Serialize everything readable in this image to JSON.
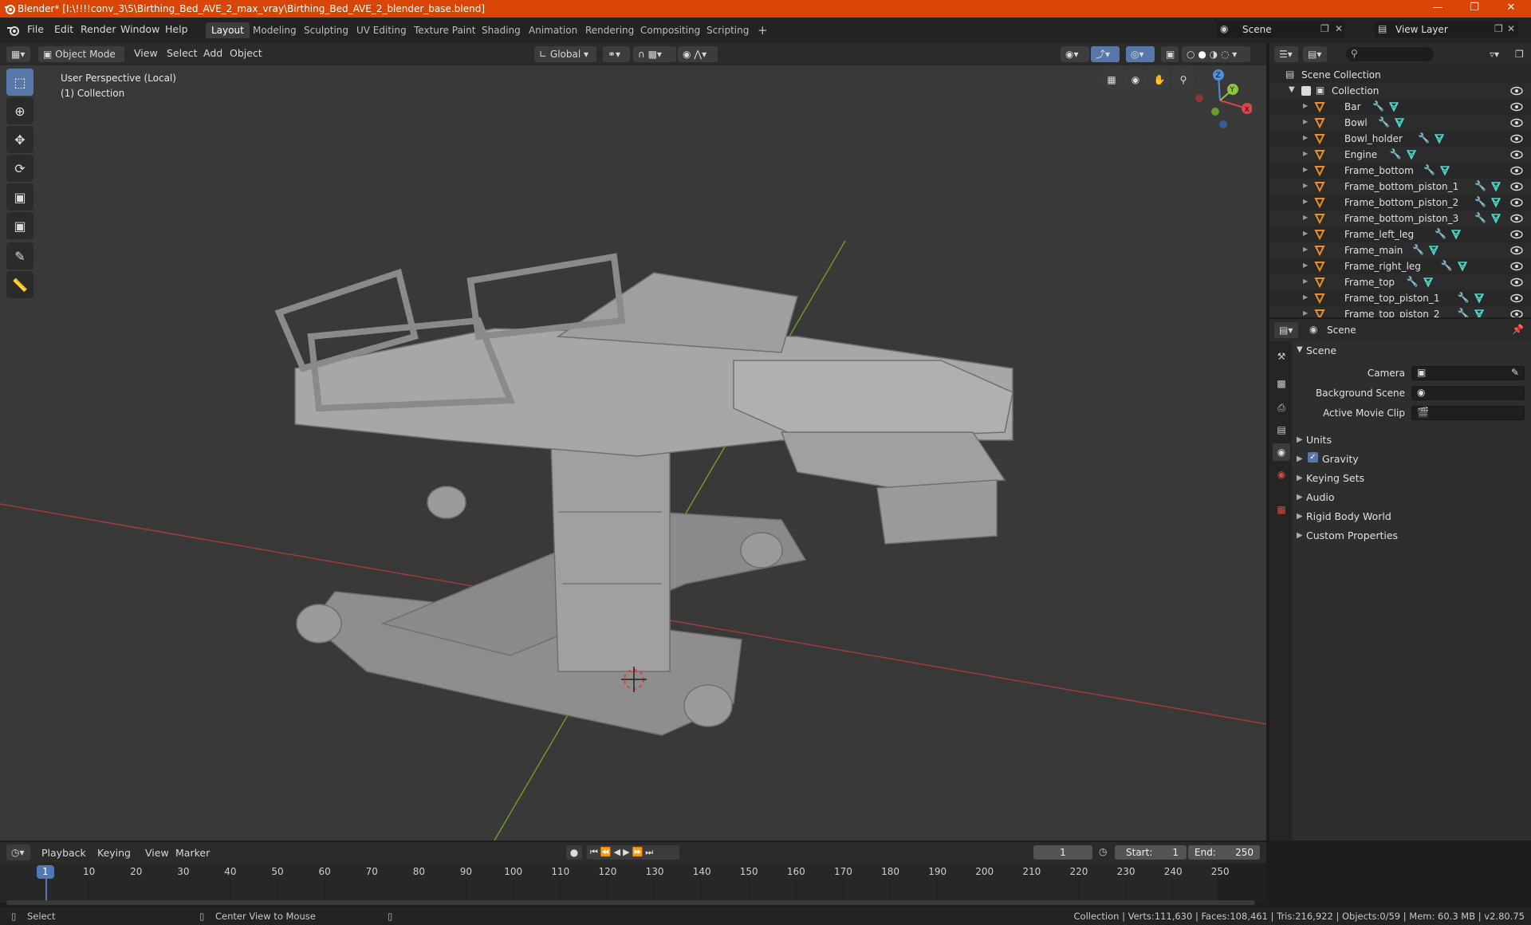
{
  "window": {
    "title": "Blender* [I:\\!!!!conv_3\\5\\Birthing_Bed_AVE_2_max_vray\\Birthing_Bed_AVE_2_blender_base.blend]",
    "min_icon": "minimize-icon",
    "max_icon": "restore-icon",
    "close_icon": "close-icon"
  },
  "menubar": {
    "menus": [
      "File",
      "Edit",
      "Render",
      "Window",
      "Help"
    ],
    "workspaces": [
      "Layout",
      "Modeling",
      "Sculpting",
      "UV Editing",
      "Texture Paint",
      "Shading",
      "Animation",
      "Rendering",
      "Compositing",
      "Scripting"
    ],
    "active_workspace": "Layout",
    "add_tab": "+",
    "scene": "Scene",
    "view_layer": "View Layer"
  },
  "viewport_header": {
    "mode": "Object Mode",
    "menus": [
      "View",
      "Select",
      "Add",
      "Object"
    ],
    "orientation": "Global"
  },
  "viewport": {
    "perspective": "User Perspective (Local)",
    "collection": "(1) Collection",
    "gizmo": {
      "x": "X",
      "y": "Y",
      "z": "Z"
    }
  },
  "outliner": {
    "root": "Scene Collection",
    "collection": "Collection",
    "items": [
      "Bar",
      "Bowl",
      "Bowl_holder",
      "Engine",
      "Frame_bottom",
      "Frame_bottom_piston_1",
      "Frame_bottom_piston_2",
      "Frame_bottom_piston_3",
      "Frame_left_leg",
      "Frame_main",
      "Frame_right_leg",
      "Frame_top",
      "Frame_top_piston_1",
      "Frame_top_piston_2"
    ]
  },
  "properties": {
    "context": "Scene",
    "panel": "Scene",
    "fields": [
      {
        "label": "Camera",
        "value": ""
      },
      {
        "label": "Background Scene",
        "value": ""
      },
      {
        "label": "Active Movie Clip",
        "value": ""
      }
    ],
    "sections": [
      "Units",
      "Gravity",
      "Keying Sets",
      "Audio",
      "Rigid Body World",
      "Custom Properties"
    ],
    "gravity_checked": true
  },
  "timeline": {
    "menus": [
      "Playback",
      "Keying",
      "View",
      "Marker"
    ],
    "current_frame": "1",
    "start_label": "Start:",
    "start": "1",
    "end_label": "End:",
    "end": "250",
    "ticks": [
      "1",
      "10",
      "20",
      "30",
      "40",
      "50",
      "60",
      "70",
      "80",
      "90",
      "100",
      "110",
      "120",
      "130",
      "140",
      "150",
      "160",
      "170",
      "180",
      "190",
      "200",
      "210",
      "220",
      "230",
      "240",
      "250"
    ]
  },
  "statusbar": {
    "left": "Select",
    "middle": "Center View to Mouse",
    "right": "Collection | Verts:111,630 | Faces:108,461 | Tris:216,922 | Objects:0/59 | Mem: 60.3 MB | v2.80.75"
  },
  "colors": {
    "titlebar": "#d94505",
    "accent": "#5677a8",
    "mesh_icon": "#e8912a",
    "modifier_icon": "#6aa5e8",
    "data_icon": "#4ed8c8"
  }
}
